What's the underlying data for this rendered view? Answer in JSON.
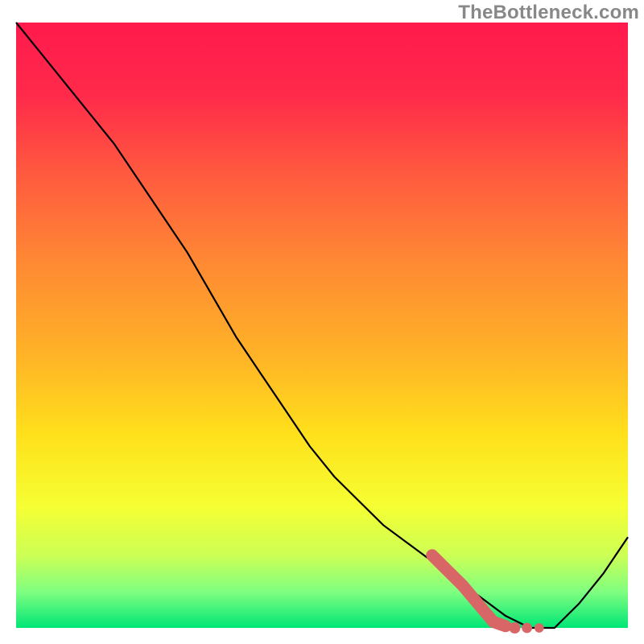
{
  "watermark": "TheBottleneck.com",
  "chart_data": {
    "type": "line",
    "title": "",
    "xlabel": "",
    "ylabel": "",
    "xlim": [
      0,
      100
    ],
    "ylim": [
      0,
      100
    ],
    "series": [
      {
        "name": "curve",
        "x": [
          0,
          4,
          8,
          12,
          16,
          20,
          24,
          28,
          32,
          36,
          40,
          44,
          48,
          52,
          56,
          60,
          64,
          68,
          72,
          76,
          80,
          82,
          84,
          86,
          88,
          92,
          96,
          100
        ],
        "values": [
          100,
          95,
          90,
          85,
          80,
          74,
          68,
          62,
          55,
          48,
          42,
          36,
          30,
          25,
          21,
          17,
          14,
          11,
          8,
          5,
          2,
          1,
          0,
          0,
          0,
          4,
          9,
          15
        ]
      }
    ],
    "annotations": {
      "marker_band": {
        "x_start": 68,
        "x_end": 85,
        "y_start": 12,
        "y_end": 0,
        "color": "#d96666"
      }
    },
    "gradient": {
      "stops": [
        {
          "pos": 0.0,
          "color": "#ff1a4d"
        },
        {
          "pos": 0.12,
          "color": "#ff2a4a"
        },
        {
          "pos": 0.25,
          "color": "#ff5a3f"
        },
        {
          "pos": 0.4,
          "color": "#ff8a33"
        },
        {
          "pos": 0.55,
          "color": "#ffb327"
        },
        {
          "pos": 0.68,
          "color": "#ffe01b"
        },
        {
          "pos": 0.8,
          "color": "#f5ff33"
        },
        {
          "pos": 0.88,
          "color": "#ccff55"
        },
        {
          "pos": 0.94,
          "color": "#80ff80"
        },
        {
          "pos": 1.0,
          "color": "#00e676"
        }
      ]
    }
  }
}
